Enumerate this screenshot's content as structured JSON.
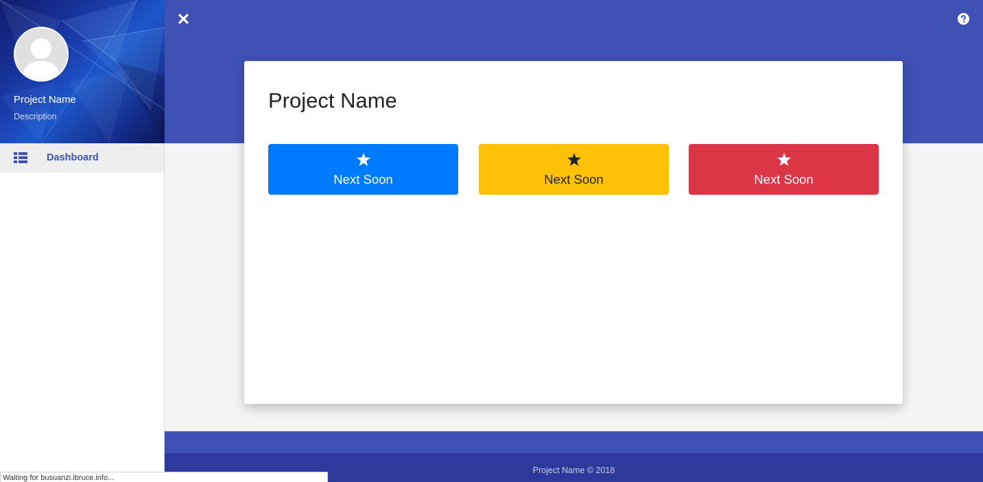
{
  "sidebar": {
    "profile": {
      "name": "Project Name",
      "description": "Description",
      "avatar_icon": "user-avatar-icon"
    },
    "nav": [
      {
        "label": "Dashboard",
        "icon": "list-icon",
        "active": true
      }
    ]
  },
  "header": {
    "close_icon": "close-icon",
    "help_icon": "help-icon"
  },
  "main": {
    "title": "Project Name",
    "tiles": [
      {
        "label": "Next Soon",
        "icon": "star-icon",
        "color": "#007bff",
        "text_color": "#ffffff"
      },
      {
        "label": "Next Soon",
        "icon": "star-icon",
        "color": "#ffc107",
        "text_color": "#212529"
      },
      {
        "label": "Next Soon",
        "icon": "star-icon",
        "color": "#dc3545",
        "text_color": "#ffffff"
      }
    ]
  },
  "footer": {
    "text": "Project Name © 2018"
  },
  "status_bar": {
    "text": "Waiting for busuanzi.ibruce.info..."
  },
  "colors": {
    "primary": "#3f51b5",
    "footer_dark": "#2d3a9b",
    "background": "#f4f4f4"
  }
}
